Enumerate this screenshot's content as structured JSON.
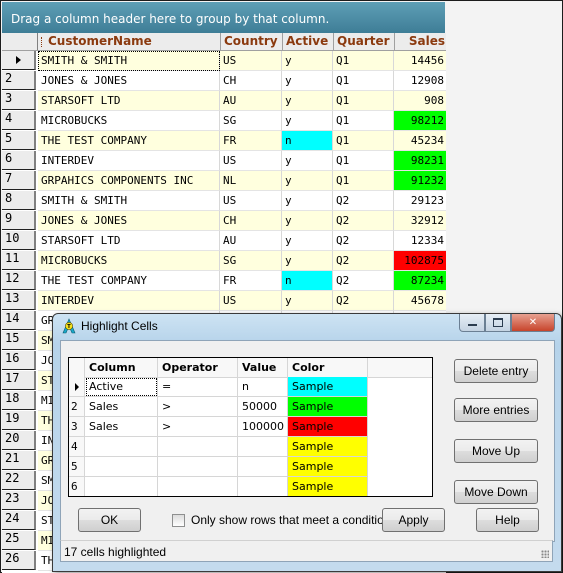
{
  "grid": {
    "group_panel_text": "Drag a column header here to group by that column.",
    "columns": [
      "CustomerName",
      "Country",
      "Active",
      "Quarter",
      "Sales"
    ],
    "rows": [
      {
        "n": "",
        "name": "SMITH & SMITH",
        "country": "US",
        "active": "y",
        "quarter": "Q1",
        "sales": "14456",
        "active_color": "",
        "sales_color": ""
      },
      {
        "n": "2",
        "name": "JONES & JONES",
        "country": "CH",
        "active": "y",
        "quarter": "Q1",
        "sales": "12908",
        "active_color": "",
        "sales_color": ""
      },
      {
        "n": "3",
        "name": "STARSOFT LTD",
        "country": "AU",
        "active": "y",
        "quarter": "Q1",
        "sales": "908",
        "active_color": "",
        "sales_color": ""
      },
      {
        "n": "4",
        "name": "MICROBUCKS",
        "country": "SG",
        "active": "y",
        "quarter": "Q1",
        "sales": "98212",
        "active_color": "",
        "sales_color": "#00ff00"
      },
      {
        "n": "5",
        "name": "THE TEST COMPANY",
        "country": "FR",
        "active": "n",
        "quarter": "Q1",
        "sales": "45234",
        "active_color": "#00ffff",
        "sales_color": ""
      },
      {
        "n": "6",
        "name": "INTERDEV",
        "country": "US",
        "active": "y",
        "quarter": "Q1",
        "sales": "98231",
        "active_color": "",
        "sales_color": "#00ff00"
      },
      {
        "n": "7",
        "name": "GRPAHICS COMPONENTS INC",
        "country": "NL",
        "active": "y",
        "quarter": "Q1",
        "sales": "91232",
        "active_color": "",
        "sales_color": "#00ff00"
      },
      {
        "n": "8",
        "name": "SMITH & SMITH",
        "country": "US",
        "active": "y",
        "quarter": "Q2",
        "sales": "29123",
        "active_color": "",
        "sales_color": ""
      },
      {
        "n": "9",
        "name": "JONES & JONES",
        "country": "CH",
        "active": "y",
        "quarter": "Q2",
        "sales": "32912",
        "active_color": "",
        "sales_color": ""
      },
      {
        "n": "10",
        "name": "STARSOFT LTD",
        "country": "AU",
        "active": "y",
        "quarter": "Q2",
        "sales": "12334",
        "active_color": "",
        "sales_color": ""
      },
      {
        "n": "11",
        "name": "MICROBUCKS",
        "country": "SG",
        "active": "y",
        "quarter": "Q2",
        "sales": "102875",
        "active_color": "",
        "sales_color": "#ff0000"
      },
      {
        "n": "12",
        "name": "THE TEST COMPANY",
        "country": "FR",
        "active": "n",
        "quarter": "Q2",
        "sales": "87234",
        "active_color": "#00ffff",
        "sales_color": "#00ff00"
      },
      {
        "n": "13",
        "name": "INTERDEV",
        "country": "US",
        "active": "y",
        "quarter": "Q2",
        "sales": "45678",
        "active_color": "",
        "sales_color": ""
      },
      {
        "n": "14",
        "name": "GR",
        "country": "",
        "active": "",
        "quarter": "",
        "sales": "",
        "active_color": "",
        "sales_color": ""
      },
      {
        "n": "15",
        "name": "SM",
        "country": "",
        "active": "",
        "quarter": "",
        "sales": "",
        "active_color": "",
        "sales_color": ""
      },
      {
        "n": "16",
        "name": "JO",
        "country": "",
        "active": "",
        "quarter": "",
        "sales": "",
        "active_color": "",
        "sales_color": ""
      },
      {
        "n": "17",
        "name": "ST",
        "country": "",
        "active": "",
        "quarter": "",
        "sales": "",
        "active_color": "",
        "sales_color": ""
      },
      {
        "n": "18",
        "name": "MI",
        "country": "",
        "active": "",
        "quarter": "",
        "sales": "",
        "active_color": "",
        "sales_color": ""
      },
      {
        "n": "19",
        "name": "TH",
        "country": "",
        "active": "",
        "quarter": "",
        "sales": "",
        "active_color": "",
        "sales_color": ""
      },
      {
        "n": "20",
        "name": "IN",
        "country": "",
        "active": "",
        "quarter": "",
        "sales": "",
        "active_color": "",
        "sales_color": ""
      },
      {
        "n": "21",
        "name": "GR",
        "country": "",
        "active": "",
        "quarter": "",
        "sales": "",
        "active_color": "",
        "sales_color": ""
      },
      {
        "n": "22",
        "name": "SM",
        "country": "",
        "active": "",
        "quarter": "",
        "sales": "",
        "active_color": "",
        "sales_color": ""
      },
      {
        "n": "23",
        "name": "JO",
        "country": "",
        "active": "",
        "quarter": "",
        "sales": "",
        "active_color": "",
        "sales_color": ""
      },
      {
        "n": "24",
        "name": "ST",
        "country": "",
        "active": "",
        "quarter": "",
        "sales": "",
        "active_color": "",
        "sales_color": ""
      },
      {
        "n": "25",
        "name": "MI",
        "country": "",
        "active": "",
        "quarter": "",
        "sales": "",
        "active_color": "",
        "sales_color": ""
      },
      {
        "n": "26",
        "name": "TH",
        "country": "",
        "active": "",
        "quarter": "",
        "sales": "",
        "active_color": "",
        "sales_color": ""
      }
    ]
  },
  "dialog": {
    "title": "Highlight Cells",
    "columns": [
      "Column",
      "Operator",
      "Value",
      "Color"
    ],
    "rules": [
      {
        "n": "",
        "column": "Active",
        "operator": "=",
        "value": "n",
        "color_label": "Sample",
        "color": "#00ffff"
      },
      {
        "n": "2",
        "column": "Sales",
        "operator": ">",
        "value": "50000",
        "color_label": "Sample",
        "color": "#00ff00"
      },
      {
        "n": "3",
        "column": "Sales",
        "operator": ">",
        "value": "100000",
        "color_label": "Sample",
        "color": "#ff0000"
      },
      {
        "n": "4",
        "column": "",
        "operator": "",
        "value": "",
        "color_label": "Sample",
        "color": "#ffff00"
      },
      {
        "n": "5",
        "column": "",
        "operator": "",
        "value": "",
        "color_label": "Sample",
        "color": "#ffff00"
      },
      {
        "n": "6",
        "column": "",
        "operator": "",
        "value": "",
        "color_label": "Sample",
        "color": "#ffff00"
      }
    ],
    "buttons": {
      "delete_entry": "Delete entry",
      "more_entries": "More entries",
      "move_up": "Move Up",
      "move_down": "Move Down",
      "ok": "OK",
      "apply": "Apply",
      "help": "Help"
    },
    "checkbox_label": "Only show rows that meet a condition",
    "checkbox_checked": false,
    "status": "17 cells highlighted",
    "window_buttons": {
      "minimize": "minimize",
      "maximize": "maximize",
      "close": "close"
    }
  }
}
